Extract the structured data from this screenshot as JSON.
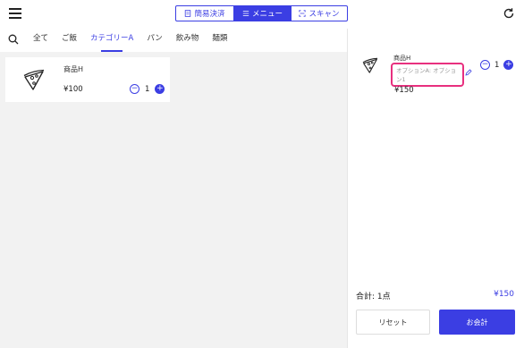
{
  "header": {
    "menu_icon": "hamburger-menu-icon",
    "tabs": [
      {
        "label": "簡易決済",
        "icon": "receipt-icon"
      },
      {
        "label": "メニュー",
        "icon": "list-icon"
      },
      {
        "label": "スキャン",
        "icon": "scan-icon"
      }
    ],
    "active_tab": "メニュー",
    "refresh_icon": "refresh-icon"
  },
  "categories": {
    "search_icon": "search-icon",
    "items": [
      "全て",
      "ご飯",
      "カテゴリーA",
      "パン",
      "飲み物",
      "麺類"
    ],
    "active": "カテゴリーA"
  },
  "products": [
    {
      "name": "商品H",
      "price": "¥100",
      "quantity": "1",
      "image_icon": "pizza-slice-icon"
    }
  ],
  "cart": {
    "items": [
      {
        "name": "商品H",
        "options": "オプションA: オプション1",
        "price": "¥150",
        "quantity": "1",
        "image_icon": "pizza-slice-icon",
        "edit_icon": "pencil-icon"
      }
    ],
    "total_label": "合計: 1点",
    "total_amount": "¥150",
    "reset_label": "リセット",
    "checkout_label": "お会計"
  },
  "colors": {
    "accent": "#3b3ee3",
    "highlight": "#e8307f",
    "background": "#f2f2f2"
  }
}
